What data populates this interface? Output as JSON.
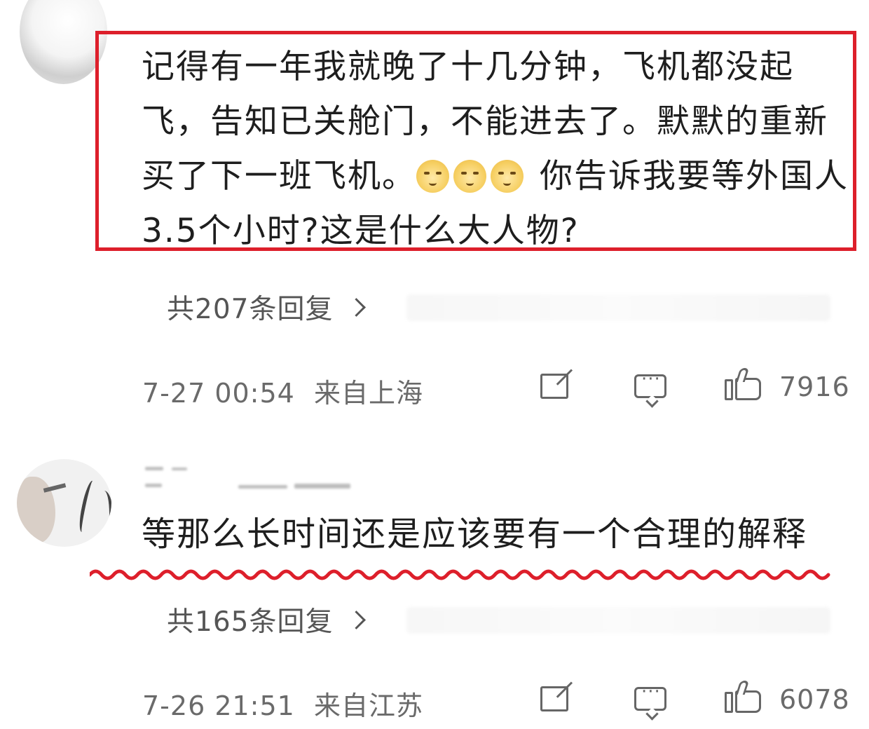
{
  "comments": [
    {
      "text_part1": "记得有一年我就晚了十几分钟，飞机都没起飞，告知已关舱门，不能进去了。默默的重新买了下一班飞机。",
      "emojis": [
        "doge-emoji",
        "doge-emoji",
        "doge-emoji"
      ],
      "text_part2": "你告诉我要等外国人3.5个小时?这是什么大人物?",
      "reply_text": "共207条回复",
      "time": "7-27 00:54",
      "location": "来自上海",
      "likes": "7916",
      "highlight": "#dd1f2b"
    },
    {
      "text": "等那么长时间还是应该要有一个合理的解释",
      "reply_text": "共165条回复",
      "time": "7-26 21:51",
      "location": "来自江苏",
      "likes": "6078",
      "underline": "#dd1f2b"
    }
  ]
}
